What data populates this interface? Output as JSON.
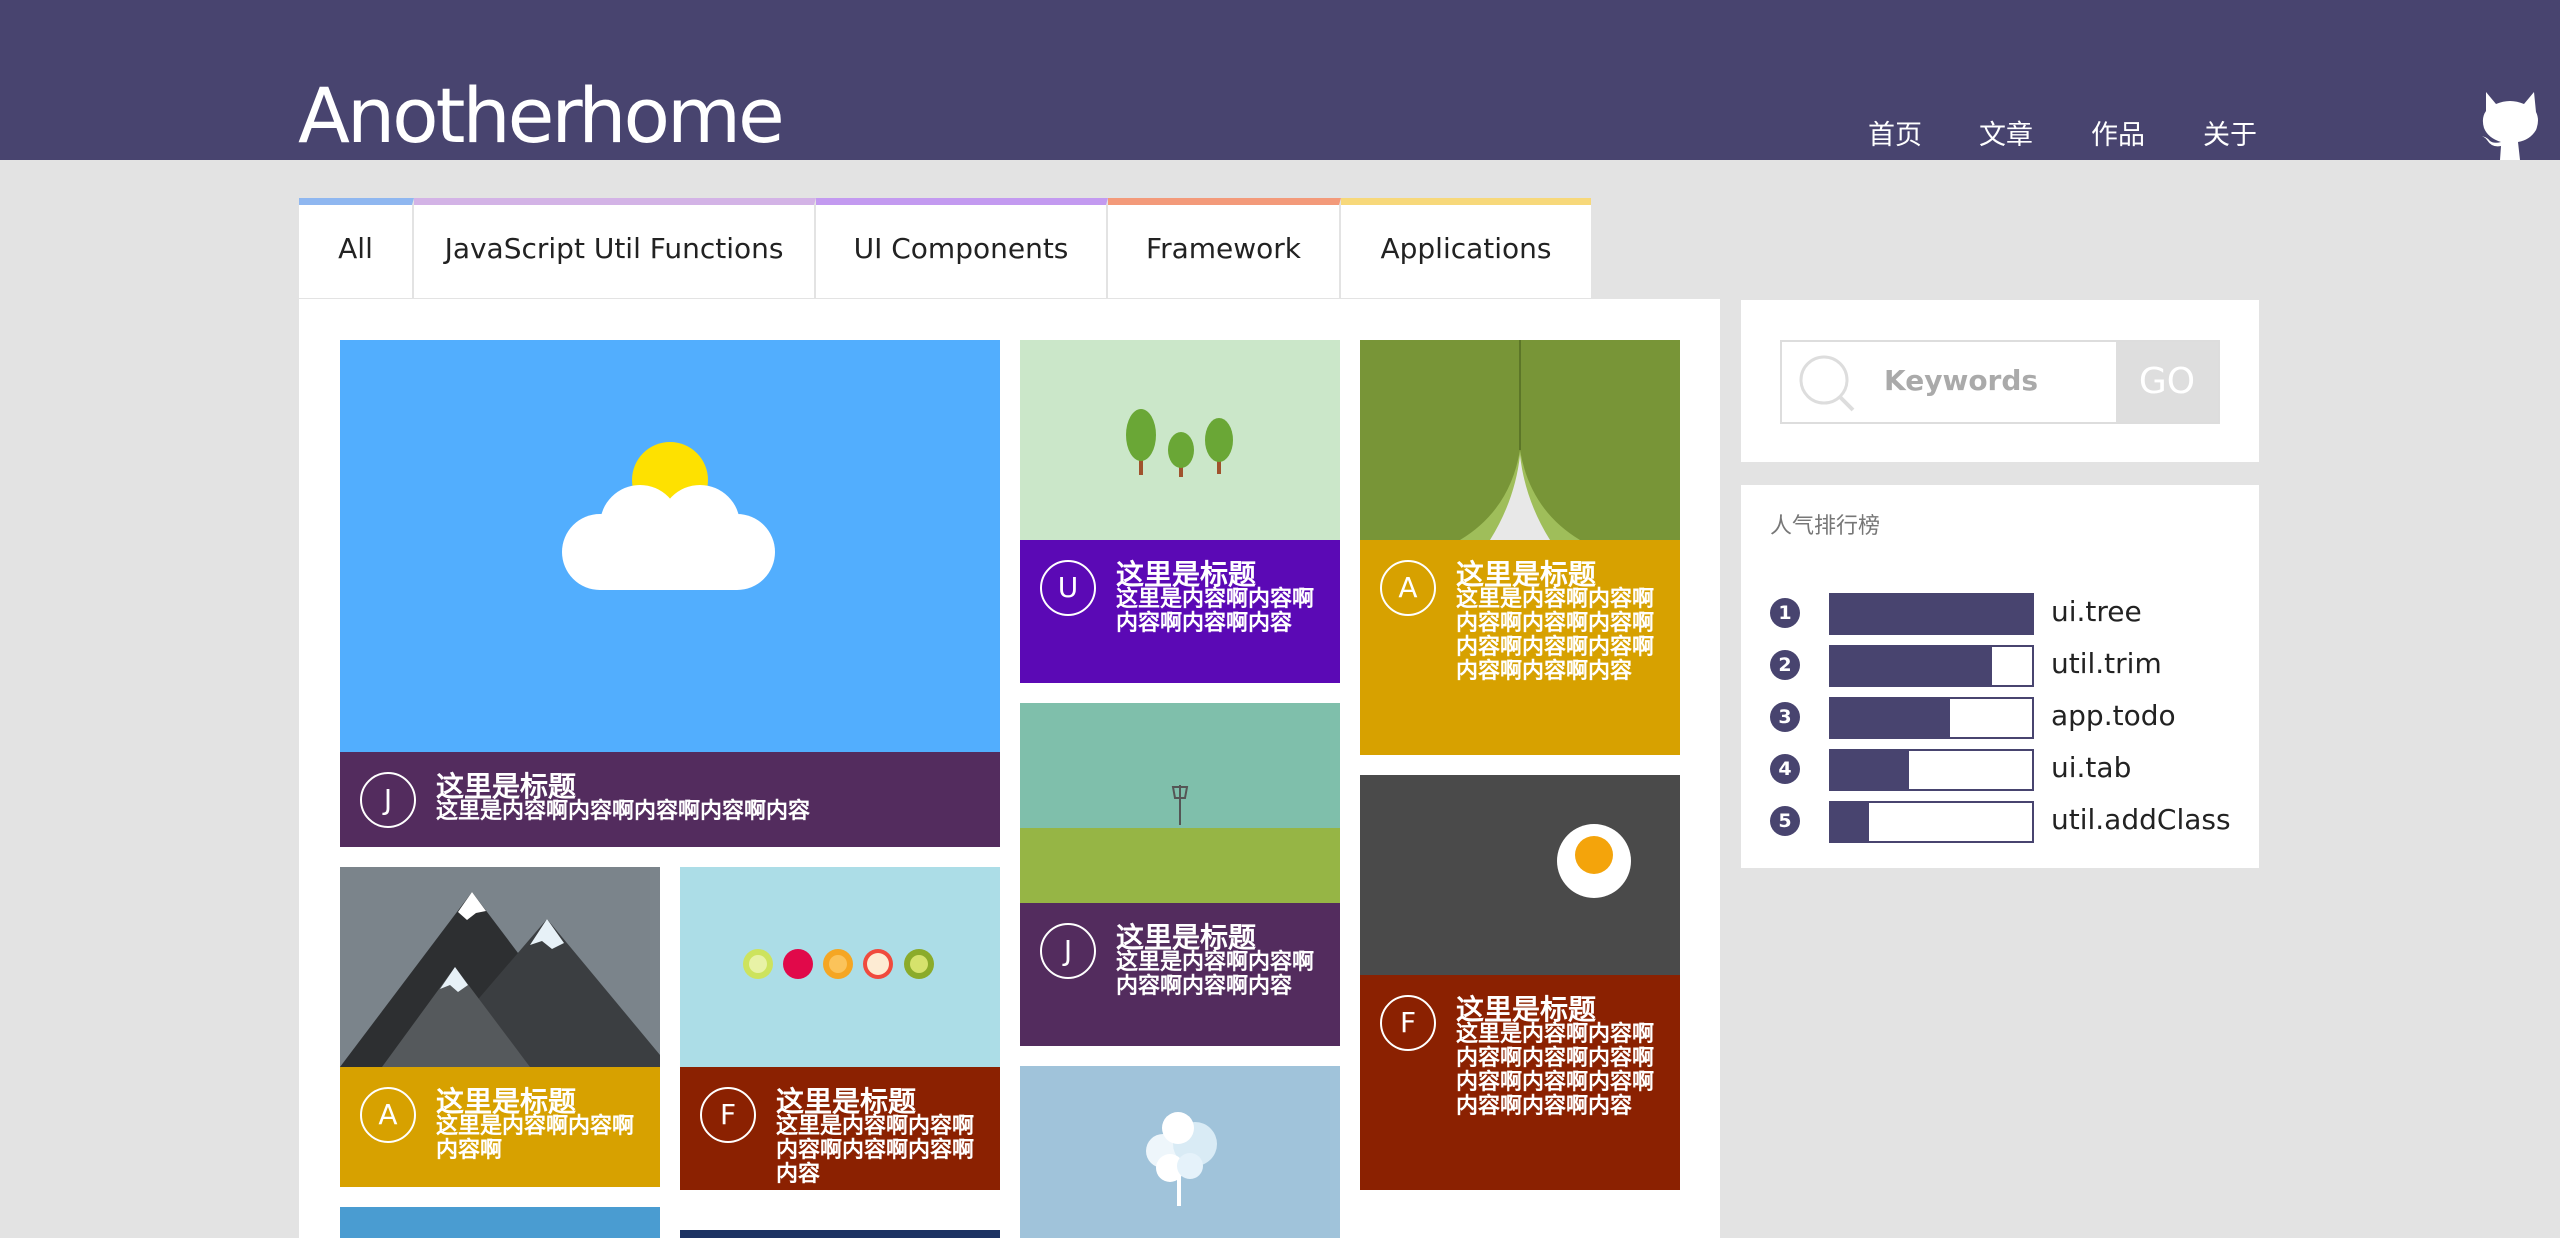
{
  "header": {
    "logo": "Anotherhome",
    "nav": [
      "首页",
      "文章",
      "作品",
      "关于"
    ],
    "github_icon": "github-octocat-icon"
  },
  "tabs": [
    {
      "label": "All",
      "color": "#8fb7f0"
    },
    {
      "label": "JavaScript Util Functions",
      "color": "#d3b3e6"
    },
    {
      "label": "UI Components",
      "color": "#c39af0"
    },
    {
      "label": "Framework",
      "color": "#f39a7a"
    },
    {
      "label": "Applications",
      "color": "#f7d87a"
    }
  ],
  "cards": [
    {
      "avatar": "J",
      "title": "这里是标题",
      "text": "这里是内容啊内容啊内容啊内容啊内容",
      "color": "#532c5e",
      "image": "cloud-sun-icon"
    },
    {
      "avatar": "U",
      "title": "这里是标题",
      "text": "这里是内容啊内容啊内容啊内容啊内容",
      "color": "#5b09b5",
      "image": "trees-icon"
    },
    {
      "avatar": "A",
      "title": "这里是标题",
      "text": "这里是内容啊内容啊内容啊内容啊内容啊内容啊内容啊内容啊内容啊内容啊内容",
      "color": "#d7a100",
      "image": "curtain-icon"
    },
    {
      "avatar": "J",
      "title": "这里是标题",
      "text": "这里是内容啊内容啊内容啊内容啊内容",
      "color": "#532c5e",
      "image": "field-sign-icon"
    },
    {
      "avatar": "F",
      "title": "这里是标题",
      "text": "这里是内容啊内容啊内容啊内容啊内容啊内容啊内容啊内容啊内容啊内容啊内容",
      "color": "#8b2101",
      "image": "egg-icon"
    },
    {
      "avatar": "A",
      "title": "这里是标题",
      "text": "这里是内容啊内容啊内容啊",
      "color": "#d7a100",
      "image": "mountains-icon"
    },
    {
      "avatar": "F",
      "title": "这里是标题",
      "text": "这里是内容啊内容啊内容啊内容啊内容啊内容",
      "color": "#8b2101",
      "image": "fruits-icon"
    },
    {
      "image": "snow-tree-icon"
    }
  ],
  "search": {
    "placeholder": "Keywords",
    "button": "GO"
  },
  "ranking": {
    "title": "人气排行榜",
    "items": [
      {
        "num": "1",
        "label": "ui.tree",
        "pct": 100
      },
      {
        "num": "2",
        "label": "util.trim",
        "pct": 80
      },
      {
        "num": "3",
        "label": "app.todo",
        "pct": 59
      },
      {
        "num": "4",
        "label": "ui.tab",
        "pct": 39
      },
      {
        "num": "5",
        "label": "util.addClass",
        "pct": 19
      }
    ]
  }
}
